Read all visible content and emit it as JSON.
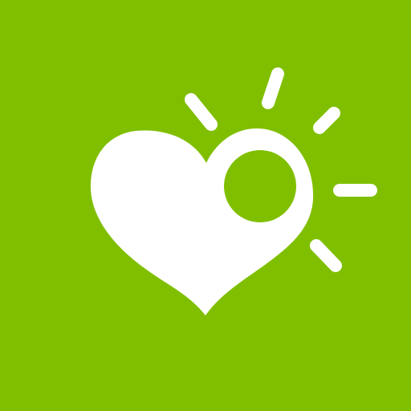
{
  "icon": {
    "name": "heart-with-sun-icon",
    "colors": {
      "background": "#80bf00",
      "foreground": "#ffffff"
    }
  }
}
